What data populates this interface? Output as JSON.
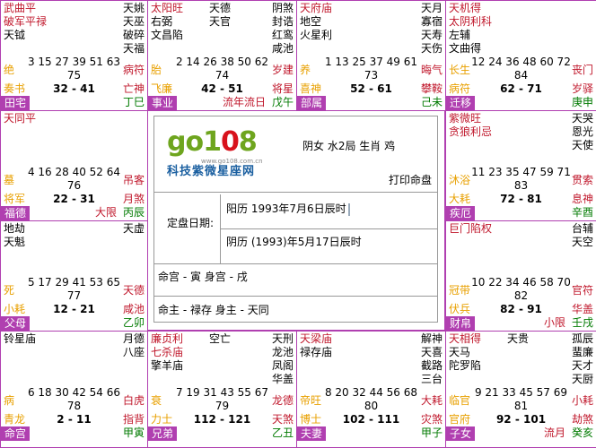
{
  "cells": [
    {
      "id": "si",
      "left_stars": [
        {
          "t": "武曲平",
          "c": "red"
        },
        {
          "t": "破军平禄",
          "c": "red"
        },
        {
          "t": "天钺",
          "c": "blk"
        }
      ],
      "mid_stars": [],
      "right_stars": [
        {
          "t": "天姚",
          "c": "blk"
        },
        {
          "t": "天巫",
          "c": "blk"
        },
        {
          "t": "破碎",
          "c": "blk"
        },
        {
          "t": "天福",
          "c": "blk"
        }
      ],
      "numbers": "3 15 27 39 51 63",
      "count": "75",
      "stage": "绝",
      "shensha": "病符",
      "god_left": "奏书",
      "age_range": "32 - 41",
      "god_right": "亡神",
      "palace": "田宅",
      "liunian": "",
      "ganzhi": "丁巳"
    },
    {
      "id": "wu",
      "left_stars": [
        {
          "t": "太阳旺",
          "c": "red"
        },
        {
          "t": "右弼",
          "c": "blk"
        },
        {
          "t": "文昌陷",
          "c": "blk"
        }
      ],
      "mid_stars": [
        {
          "t": "天德",
          "c": "blk"
        },
        {
          "t": "天官",
          "c": "blk"
        }
      ],
      "right_stars": [
        {
          "t": "阴煞",
          "c": "blk"
        },
        {
          "t": "封诰",
          "c": "blk"
        },
        {
          "t": "红鸾",
          "c": "blk"
        },
        {
          "t": "咸池",
          "c": "blk"
        }
      ],
      "numbers": "2 14 26 38 50 62",
      "count": "74",
      "stage": "胎",
      "shensha": "岁建",
      "god_left": "飞廉",
      "age_range": "42 - 51",
      "god_right": "将星",
      "palace": "事业",
      "liunian": "流年流日",
      "ganzhi": "戊午"
    },
    {
      "id": "wei",
      "left_stars": [
        {
          "t": "天府庙",
          "c": "red"
        },
        {
          "t": "地空",
          "c": "blk"
        },
        {
          "t": "火星利",
          "c": "blk"
        }
      ],
      "mid_stars": [],
      "right_stars": [
        {
          "t": "天月",
          "c": "blk"
        },
        {
          "t": "寡宿",
          "c": "blk"
        },
        {
          "t": "天寿",
          "c": "blk"
        },
        {
          "t": "天伤",
          "c": "blk"
        }
      ],
      "numbers": "1 13 25 37 49 61",
      "count": "73",
      "stage": "养",
      "shensha": "晦气",
      "god_left": "喜神",
      "age_range": "52 - 61",
      "god_right": "攀鞍",
      "palace": "部属",
      "liunian": "",
      "ganzhi": "己未"
    },
    {
      "id": "shen",
      "left_stars": [
        {
          "t": "天机得",
          "c": "red"
        },
        {
          "t": "太阴利科",
          "c": "red"
        },
        {
          "t": "左辅",
          "c": "blk"
        },
        {
          "t": "文曲得",
          "c": "blk"
        }
      ],
      "mid_stars": [],
      "right_stars": [],
      "numbers": "12 24 36 48 60 72",
      "count": "84",
      "stage": "长生",
      "shensha": "丧门",
      "god_left": "病符",
      "age_range": "62 - 71",
      "god_right": "岁驿",
      "palace": "迁移",
      "liunian": "",
      "ganzhi": "庚申"
    },
    {
      "id": "chen",
      "left_stars": [
        {
          "t": "天同平",
          "c": "red"
        }
      ],
      "mid_stars": [],
      "right_stars": [],
      "numbers": "4 16 28 40 52 64",
      "count": "76",
      "stage": "墓",
      "shensha": "吊客",
      "god_left": "将军",
      "age_range": "22 - 31",
      "god_right": "月煞",
      "palace": "福德",
      "liunian": "大限",
      "ganzhi": "丙辰"
    },
    {
      "id": "you",
      "left_stars": [
        {
          "t": "紫微旺",
          "c": "red"
        },
        {
          "t": "贪狼利忌",
          "c": "red"
        }
      ],
      "mid_stars": [],
      "right_stars": [
        {
          "t": "天哭",
          "c": "blk"
        },
        {
          "t": "恩光",
          "c": "blk"
        },
        {
          "t": "天使",
          "c": "blk"
        }
      ],
      "numbers": "11 23 35 47 59 71",
      "count": "83",
      "stage": "沐浴",
      "shensha": "贯索",
      "god_left": "大耗",
      "age_range": "72 - 81",
      "god_right": "息神",
      "palace": "疾厄",
      "liunian": "",
      "ganzhi": "辛酉"
    },
    {
      "id": "mao",
      "left_stars": [
        {
          "t": "地劫",
          "c": "blk"
        },
        {
          "t": "天魁",
          "c": "blk"
        }
      ],
      "mid_stars": [],
      "right_stars": [
        {
          "t": "天虚",
          "c": "blk"
        }
      ],
      "numbers": "5 17 29 41 53 65",
      "count": "77",
      "stage": "死",
      "shensha": "天德",
      "god_left": "小耗",
      "age_range": "12 - 21",
      "god_right": "咸池",
      "palace": "父母",
      "liunian": "",
      "ganzhi": "乙卯"
    },
    {
      "id": "xu",
      "left_stars": [
        {
          "t": "巨门陷权",
          "c": "red"
        }
      ],
      "mid_stars": [],
      "right_stars": [
        {
          "t": "台辅",
          "c": "blk"
        },
        {
          "t": "天空",
          "c": "blk"
        }
      ],
      "numbers": "10 22 34 46 58 70",
      "count": "82",
      "stage": "冠带",
      "shensha": "官符",
      "god_left": "伏兵",
      "age_range": "82 - 91",
      "god_right": "华盖",
      "palace": "财帛",
      "liunian": "小限",
      "ganzhi": "壬戌"
    },
    {
      "id": "yin",
      "left_stars": [
        {
          "t": "铃星庙",
          "c": "blk"
        }
      ],
      "mid_stars": [],
      "right_stars": [
        {
          "t": "月德",
          "c": "blk"
        },
        {
          "t": "八座",
          "c": "blk"
        }
      ],
      "numbers": "6 18 30 42 54 66",
      "count": "78",
      "stage": "病",
      "shensha": "白虎",
      "god_left": "青龙",
      "age_range": "2 - 11",
      "god_right": "指背",
      "palace": "命宫",
      "liunian": "",
      "ganzhi": "甲寅"
    },
    {
      "id": "chou",
      "left_stars": [
        {
          "t": "廉贞利",
          "c": "red"
        },
        {
          "t": "七杀庙",
          "c": "red"
        },
        {
          "t": "擎羊庙",
          "c": "blk"
        }
      ],
      "mid_stars": [
        {
          "t": "空亡",
          "c": "blk"
        }
      ],
      "right_stars": [
        {
          "t": "天刑",
          "c": "blk"
        },
        {
          "t": "龙池",
          "c": "blk"
        },
        {
          "t": "凤阁",
          "c": "blk"
        },
        {
          "t": "华盖",
          "c": "blk"
        }
      ],
      "numbers": "7 19 31 43 55 67",
      "count": "79",
      "stage": "衰",
      "shensha": "龙德",
      "god_left": "力士",
      "age_range": "112 - 121",
      "god_right": "天煞",
      "palace": "兄弟",
      "liunian": "",
      "ganzhi": "乙丑"
    },
    {
      "id": "zi",
      "left_stars": [
        {
          "t": "天梁庙",
          "c": "red"
        },
        {
          "t": "禄存庙",
          "c": "blk"
        }
      ],
      "mid_stars": [],
      "right_stars": [
        {
          "t": "解神",
          "c": "blk"
        },
        {
          "t": "天喜",
          "c": "blk"
        },
        {
          "t": "截路",
          "c": "blk"
        },
        {
          "t": "三台",
          "c": "blk"
        }
      ],
      "numbers": "8 20 32 44 56 68",
      "count": "80",
      "stage": "帝旺",
      "shensha": "大耗",
      "god_left": "博士",
      "age_range": "102 - 111",
      "god_right": "灾煞",
      "palace": "夫妻",
      "liunian": "",
      "ganzhi": "甲子"
    },
    {
      "id": "hai",
      "left_stars": [
        {
          "t": "天相得",
          "c": "red"
        },
        {
          "t": "天马",
          "c": "blk"
        },
        {
          "t": "陀罗陷",
          "c": "blk"
        }
      ],
      "mid_stars": [
        {
          "t": "天贵",
          "c": "blk"
        }
      ],
      "right_stars": [
        {
          "t": "孤辰",
          "c": "blk"
        },
        {
          "t": "蜚廉",
          "c": "blk"
        },
        {
          "t": "天才",
          "c": "blk"
        },
        {
          "t": "天厨",
          "c": "blk"
        }
      ],
      "numbers": "9 21 33 45 57 69",
      "count": "81",
      "stage": "临官",
      "shensha": "小耗",
      "god_left": "官府",
      "age_range": "92 - 101",
      "god_right": "劫煞",
      "palace": "子女",
      "liunian": "流月",
      "ganzhi": "癸亥"
    }
  ],
  "center": {
    "logo_text_a": "go1",
    "logo_text_b": "0",
    "logo_text_c": "8",
    "logo_url": "www.go108.com.cn",
    "logo_tagline": "科技紫微星座网",
    "info": "阴女 水2局 生肖 鸡",
    "print_label": "打印命盘",
    "date_label": "定盘日期:",
    "solar_date": "阳历 1993年7月6日辰时",
    "lunar_date": "阴历 (1993)年5月17日辰时",
    "ming_line": "命宫 - 寅  身宫 - 戌",
    "zhu_line": "命主 - 禄存  身主 - 天同"
  },
  "colors": {
    "border": "#b03fb0",
    "red": "#c0182c",
    "orange": "#e8a000",
    "green": "#007a00",
    "logo_green": "#6ea51e",
    "logo_red": "#d8121c",
    "tagline": "#1a5fa0"
  }
}
